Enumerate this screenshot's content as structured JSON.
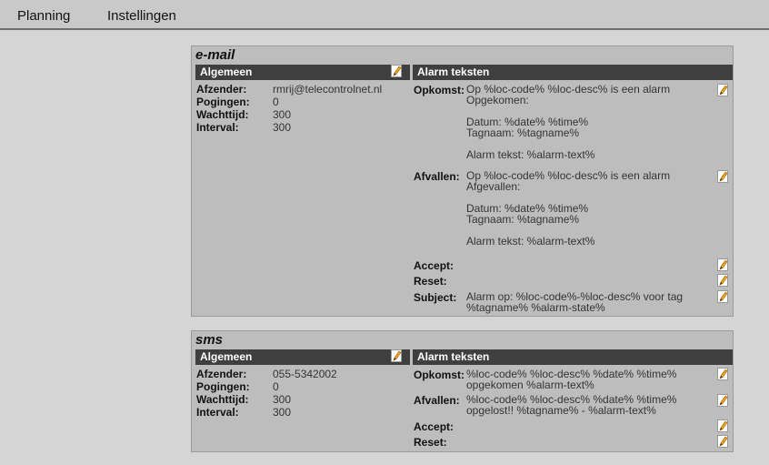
{
  "menu": {
    "items": [
      {
        "label": "Planning"
      },
      {
        "label": "Instellingen"
      }
    ]
  },
  "email": {
    "title": "e-mail",
    "general_header": "Algemeen",
    "alarm_header": "Alarm teksten",
    "fields": [
      {
        "label": "Afzender:",
        "value": "rmrij@telecontrolnet.nl"
      },
      {
        "label": "Pogingen:",
        "value": "0"
      },
      {
        "label": "Wachttijd:",
        "value": "300"
      },
      {
        "label": "Interval:",
        "value": "300"
      }
    ],
    "alarms": [
      {
        "label": "Opkomst:",
        "value": "Op %loc-code% %loc-desc% is een alarm\nOpgekomen:\n\nDatum: %date% %time%\nTagnaam: %tagname%\n\nAlarm tekst: %alarm-text%"
      },
      {
        "label": "Afvallen:",
        "value": "Op %loc-code% %loc-desc% is een alarm\nAfgevallen:\n\nDatum: %date% %time%\nTagnaam: %tagname%\n\nAlarm tekst: %alarm-text%"
      },
      {
        "label": "Accept:",
        "value": ""
      },
      {
        "label": "Reset:",
        "value": ""
      },
      {
        "label": "Subject:",
        "value": "Alarm op: %loc-code%-%loc-desc% voor tag\n%tagname% %alarm-state%"
      }
    ]
  },
  "sms": {
    "title": "sms",
    "general_header": "Algemeen",
    "alarm_header": "Alarm teksten",
    "fields": [
      {
        "label": "Afzender:",
        "value": "055-5342002"
      },
      {
        "label": "Pogingen:",
        "value": "0"
      },
      {
        "label": "Wachttijd:",
        "value": "300"
      },
      {
        "label": "Interval:",
        "value": "300"
      }
    ],
    "alarms": [
      {
        "label": "Opkomst:",
        "value": "%loc-code% %loc-desc% %date% %time%\nopgekomen %alarm-text%"
      },
      {
        "label": "Afvallen:",
        "value": "%loc-code% %loc-desc% %date% %time%\nopgelost!! %tagname% - %alarm-text%"
      },
      {
        "label": "Accept:",
        "value": ""
      },
      {
        "label": "Reset:",
        "value": ""
      }
    ]
  }
}
